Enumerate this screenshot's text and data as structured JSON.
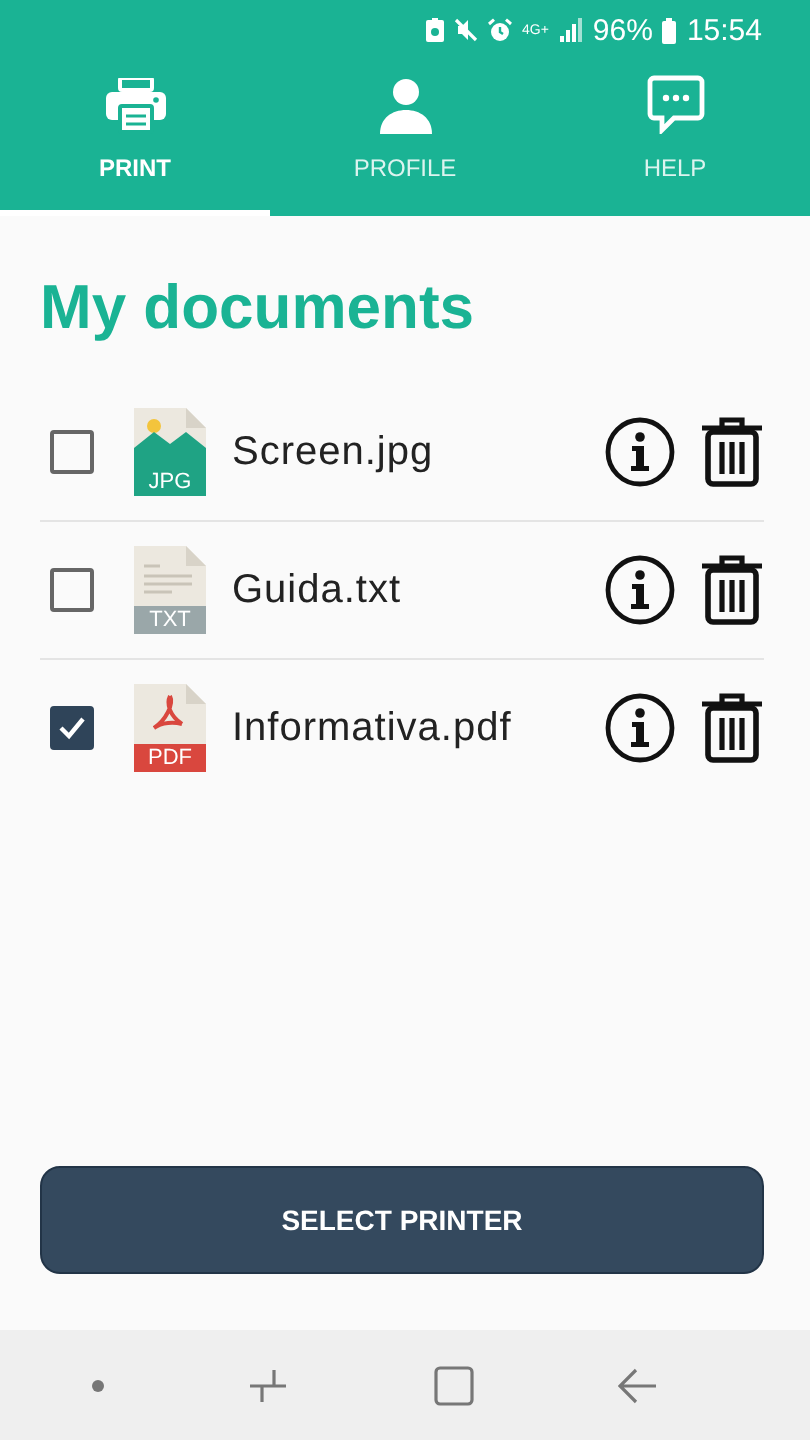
{
  "status_bar": {
    "network": "4G+",
    "battery": "96%",
    "time": "15:54"
  },
  "tabs": [
    {
      "kind": "print",
      "label": "PRINT",
      "selected": true
    },
    {
      "kind": "profile",
      "label": "PROFILE",
      "selected": false
    },
    {
      "kind": "help",
      "label": "HELP",
      "selected": false
    }
  ],
  "title": "My documents",
  "documents": [
    {
      "kind": "jpg",
      "badge": "JPG",
      "name": "Screen.jpg",
      "checked": false
    },
    {
      "kind": "txt",
      "badge": "TXT",
      "name": "Guida.txt",
      "checked": false
    },
    {
      "kind": "pdf",
      "badge": "PDF",
      "name": "Informativa.pdf",
      "checked": true
    }
  ],
  "primary_button": "SELECT PRINTER"
}
